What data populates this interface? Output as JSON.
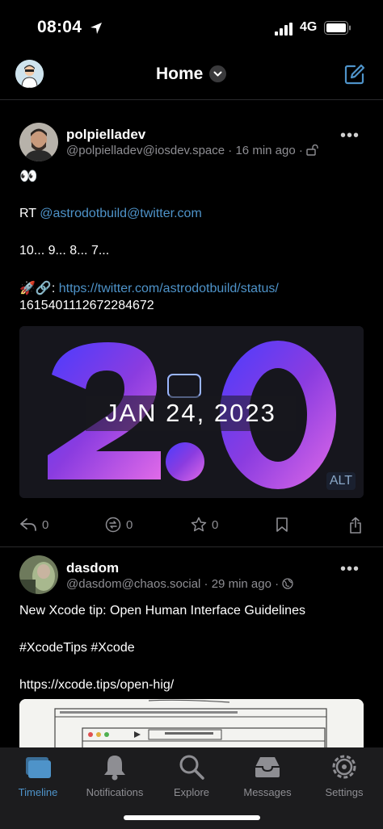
{
  "status_bar": {
    "time": "08:04",
    "network": "4G"
  },
  "header": {
    "title": "Home"
  },
  "posts": [
    {
      "name": "polpielladev",
      "handle": "@polpielladev@iosdev.space",
      "time": "16 min ago",
      "emoji_line": "👀",
      "rt_prefix": "RT ",
      "rt_mention": "@astrodotbuild@twitter.com",
      "countdown": "10... 9... 8... 7...",
      "link_prefix": "🚀🔗: ",
      "link_line1": "https://twitter.com/astrodotbuild/status/",
      "link_line2": "1615401112672284672",
      "image_text": "JAN 24, 2023",
      "alt_label": "ALT",
      "reply_count": "0",
      "boost_count": "0",
      "fav_count": "0"
    },
    {
      "name": "dasdom",
      "handle": "@dasdom@chaos.social",
      "time": "29 min ago",
      "text": "New Xcode tip: Open Human Interface Guidelines",
      "tags": "#XcodeTips #Xcode",
      "link": "https://xcode.tips/open-hig/"
    }
  ],
  "tabs": [
    {
      "label": "Timeline",
      "icon": "timeline-icon",
      "active": true
    },
    {
      "label": "Notifications",
      "icon": "bell-icon",
      "active": false
    },
    {
      "label": "Explore",
      "icon": "search-icon",
      "active": false
    },
    {
      "label": "Messages",
      "icon": "inbox-icon",
      "active": false
    },
    {
      "label": "Settings",
      "icon": "gear-icon",
      "active": false
    }
  ],
  "colors": {
    "accent": "#4e93c9",
    "background": "#000000",
    "tabbar": "#1c1c1e"
  }
}
